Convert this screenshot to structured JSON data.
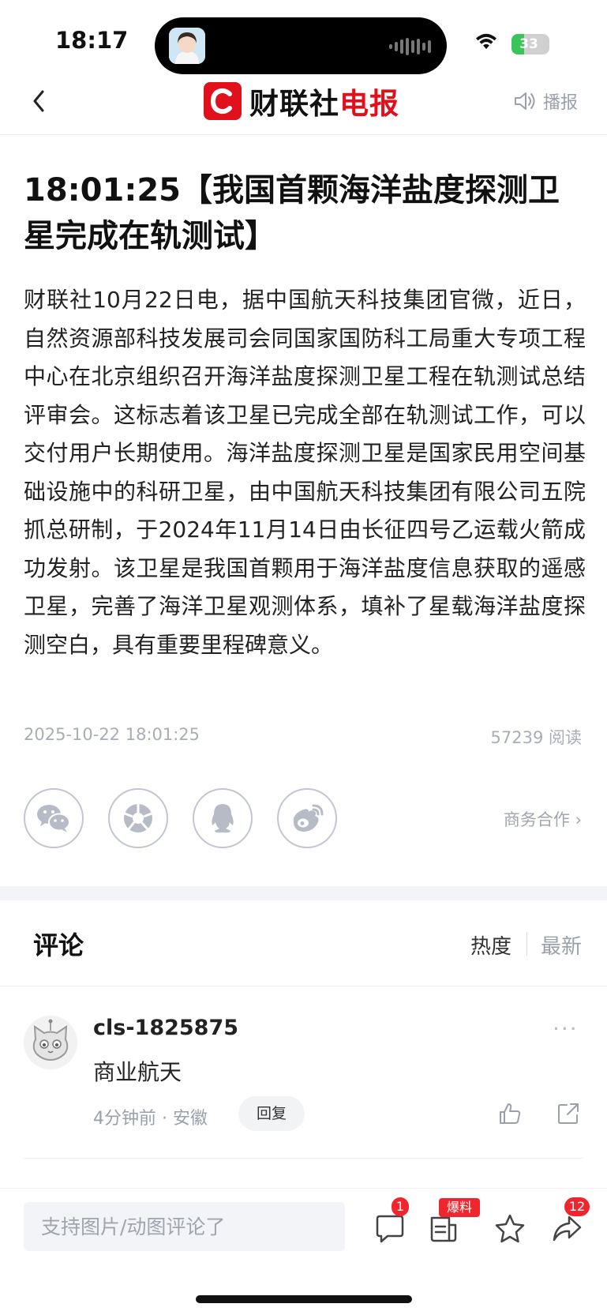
{
  "status_bar": {
    "time": "18:17",
    "battery": "33",
    "battery_level": 0.33
  },
  "nav": {
    "brand_black": "财联社",
    "brand_red": "电报",
    "broadcast_label": "播报"
  },
  "article": {
    "title": "18:01:25【我国首颗海洋盐度探测卫星完成在轨测试】",
    "body": "财联社10月22日电，据中国航天科技集团官微，近日，自然资源部科技发展司会同国家国防科工局重大专项工程中心在北京组织召开海洋盐度探测卫星工程在轨测试总结评审会。这标志着该卫星已完成全部在轨测试工作，可以交付用户长期使用。海洋盐度探测卫星是国家民用空间基础设施中的科研卫星，由中国航天科技集团有限公司五院抓总研制，于2024年11月14日由长征四号乙运载火箭成功发射。该卫星是我国首颗用于海洋盐度信息获取的遥感卫星，完善了海洋卫星观测体系，填补了星载海洋盐度探测空白，具有重要里程碑意义。",
    "date": "2025-10-22 18:01:25",
    "reads": "57239 阅读"
  },
  "share": {
    "icons": [
      "wechat-icon",
      "moments-icon",
      "qq-icon",
      "weibo-icon"
    ],
    "business_label": "商务合作 ›"
  },
  "comments": {
    "title": "评论",
    "sort_hot": "热度",
    "sort_new": "最新",
    "items": [
      {
        "user": "cls-1825875",
        "text": "商业航天",
        "meta": "4分钟前 · 安徽",
        "reply_label": "回复",
        "more": "···"
      }
    ]
  },
  "bottom_bar": {
    "input_placeholder": "支持图片/动图评论了",
    "comment_badge": "1",
    "report_badge": "爆料",
    "share_badge": "12"
  },
  "colors": {
    "brand_red": "#e0101d",
    "badge_red": "#f0262f",
    "muted": "#a8adb7"
  }
}
